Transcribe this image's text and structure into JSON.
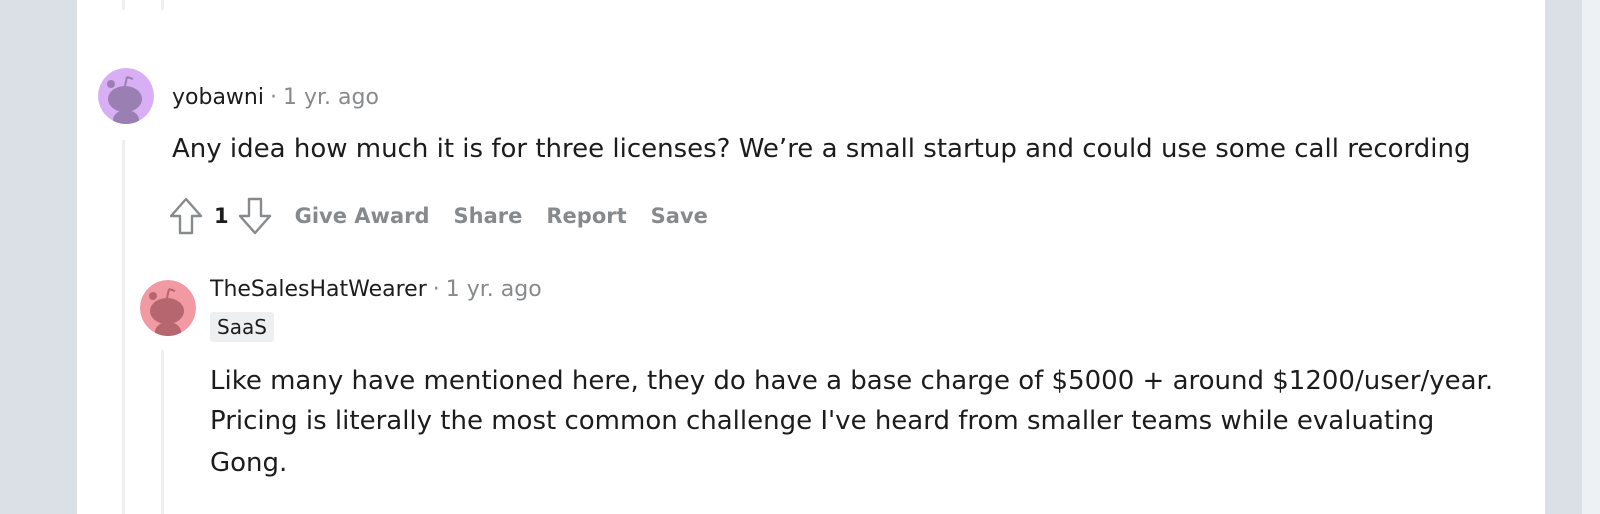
{
  "comments": [
    {
      "author": "yobawni",
      "separator": "·",
      "time": "1 yr. ago",
      "body": "Any idea how much it is for three licenses? We’re a small startup and could use some call recording",
      "score": "1",
      "actions": {
        "give_award": "Give Award",
        "share": "Share",
        "report": "Report",
        "save": "Save"
      },
      "avatar_color": "#d8aef5"
    },
    {
      "author": "TheSalesHatWearer",
      "separator": "·",
      "time": "1 yr. ago",
      "flair": "SaaS",
      "body_lines": [
        "Like many have mentioned here, they do have a base charge of $5000 + around $1200/user/year.",
        "Pricing is literally the most common challenge I've heard from smaller teams while evaluating",
        "Gong."
      ],
      "avatar_color": "#f29aa4"
    }
  ],
  "icons": {
    "upvote": "upvote-arrow-icon",
    "downvote": "downvote-arrow-icon",
    "avatar": "snoo-avatar-icon"
  }
}
